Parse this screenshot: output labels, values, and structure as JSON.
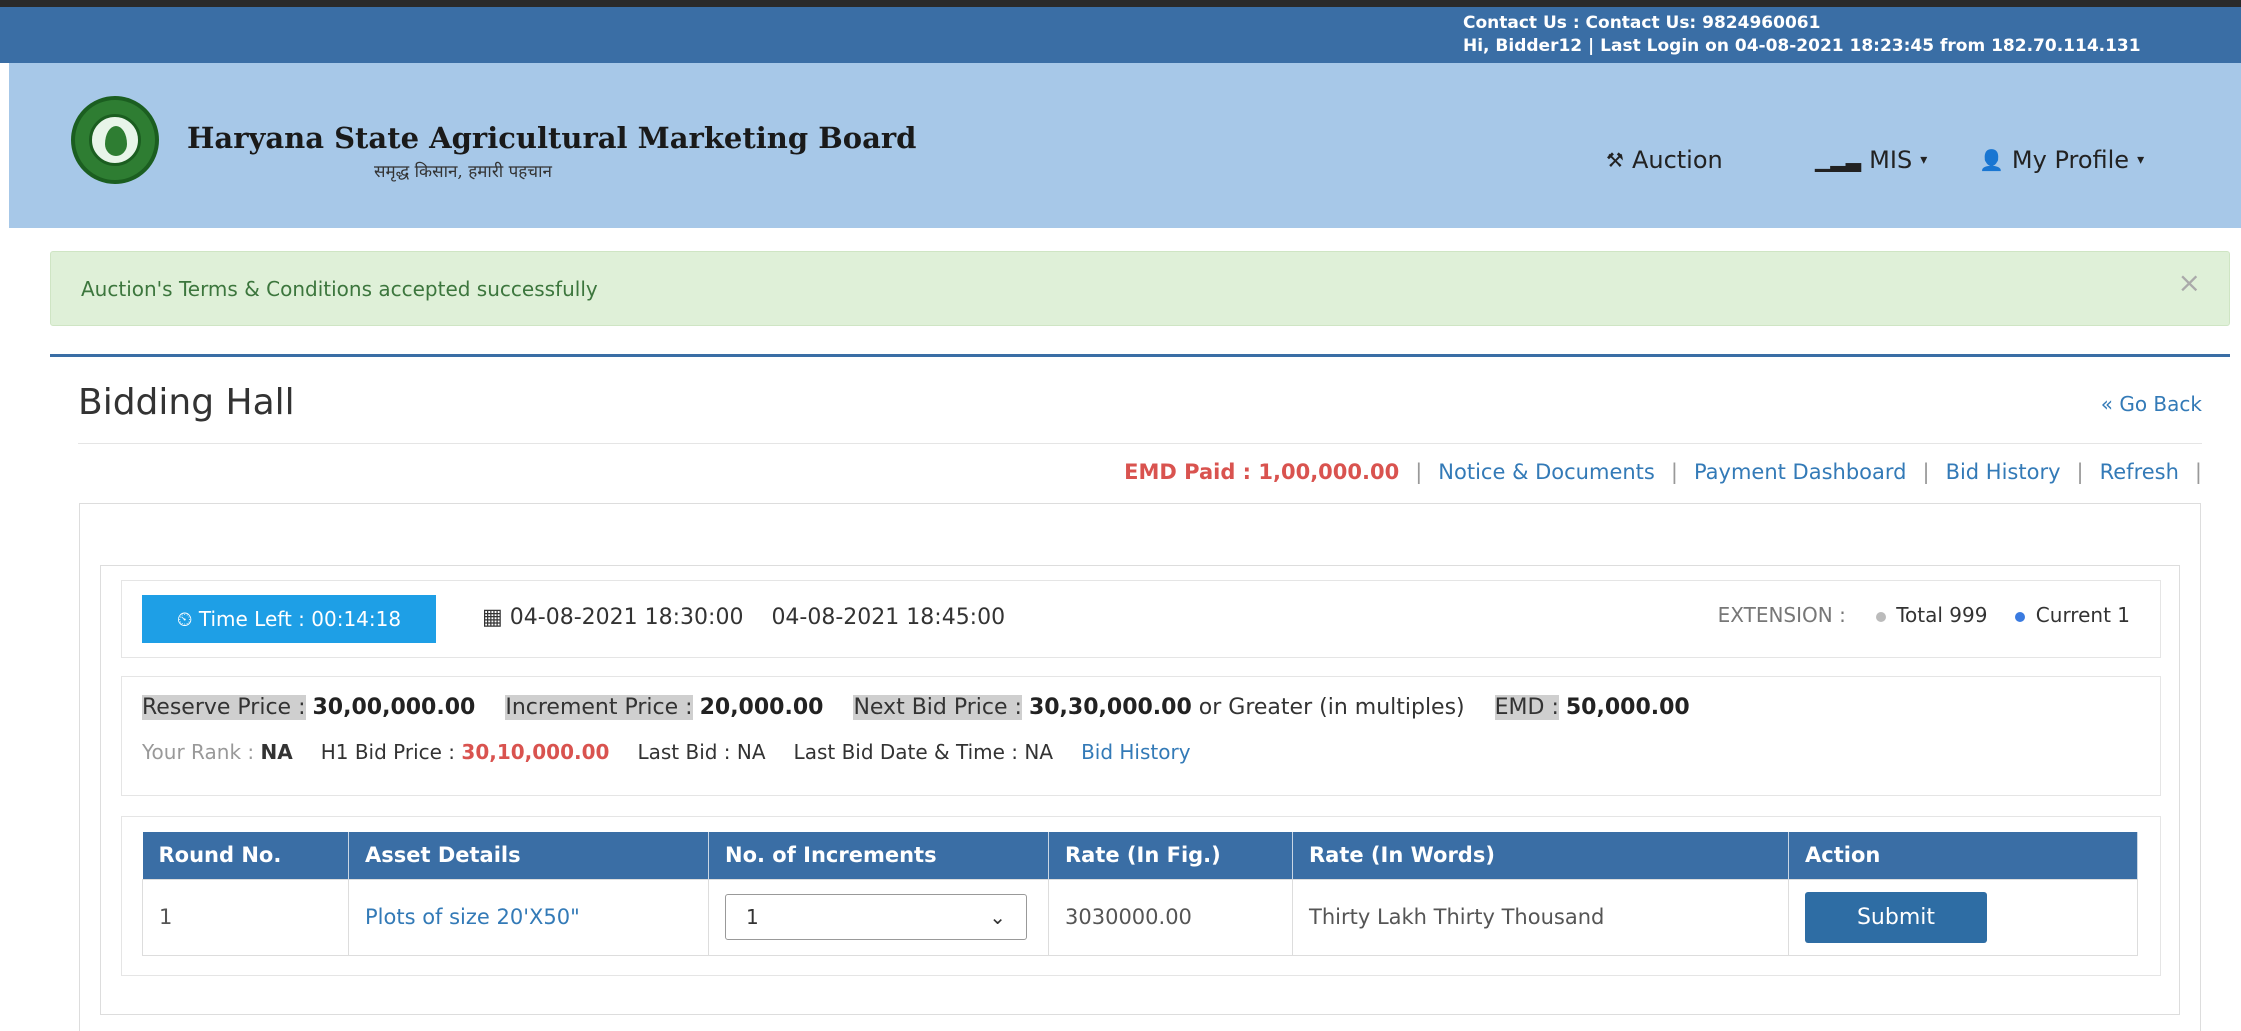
{
  "topbar": {
    "contact": "Contact Us : Contact Us: 9824960061",
    "login_info": "Hi, Bidder12 | Last Login on 04-08-2021 18:23:45 from 182.70.114.131"
  },
  "header": {
    "title": "Haryana State Agricultural Marketing Board",
    "subtitle": "समृद्ध किसान, हमारी पहचान",
    "nav": {
      "auction": "Auction",
      "mis": "MIS",
      "profile": "My Profile"
    }
  },
  "alert": {
    "message": "Auction's Terms & Conditions accepted successfully",
    "close": "×"
  },
  "page": {
    "title": "Bidding Hall",
    "go_back": "« Go Back"
  },
  "links": {
    "emd_paid": "EMD Paid : 1,00,000.00",
    "notice": "Notice & Documents",
    "payment": "Payment Dashboard",
    "bid_history": "Bid History",
    "refresh": "Refresh"
  },
  "timer": {
    "time_left": "Time Left : 00:14:18",
    "start": "04-08-2021 18:30:00",
    "end": "04-08-2021 18:45:00",
    "extension_label": "EXTENSION :",
    "total": "Total 999",
    "current": "Current 1",
    "total_color": "#bbbbbb",
    "current_color": "#3a7be0"
  },
  "prices": {
    "reserve_label": "Reserve Price :",
    "reserve_value": "30,00,000.00",
    "increment_label": "Increment Price :",
    "increment_value": "20,000.00",
    "next_label": "Next Bid Price :",
    "next_value": "30,30,000.00",
    "next_suffix": "or Greater",
    "next_note": "(in multiples)",
    "emd_label": "EMD :",
    "emd_value": "50,000.00",
    "rank_label": "Your Rank :",
    "rank_value": "NA",
    "h1_label": "H1 Bid Price :",
    "h1_value": "30,10,000.00",
    "last_bid": "Last Bid : NA",
    "last_bid_time": "Last Bid Date & Time : NA",
    "bid_history": "Bid History"
  },
  "table": {
    "headers": [
      "Round No.",
      "Asset Details",
      "No. of Increments",
      "Rate (In Fig.)",
      "Rate (In Words)",
      "Action"
    ],
    "row": {
      "round": "1",
      "asset": "Plots of size 20'X50\"",
      "increments": "1",
      "rate_fig": "3030000.00",
      "rate_words": "Thirty Lakh Thirty Thousand",
      "action": "Submit"
    }
  }
}
